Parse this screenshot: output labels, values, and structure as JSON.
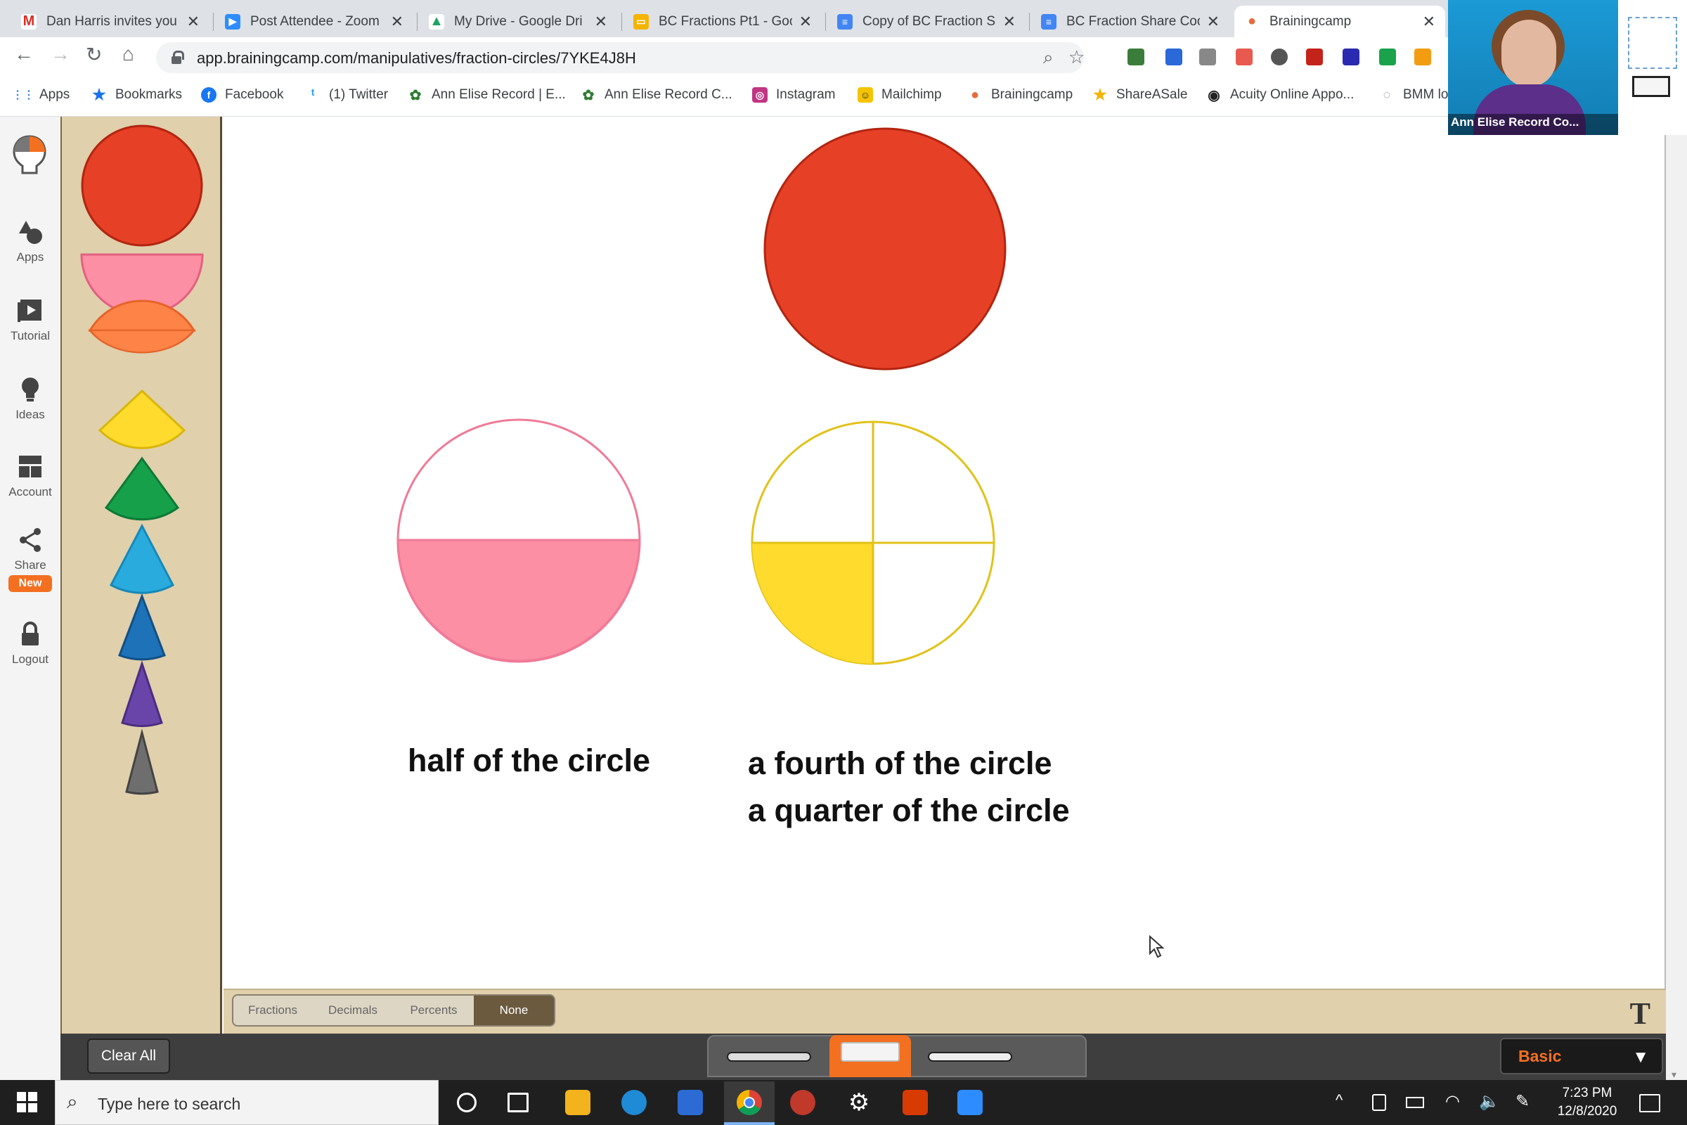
{
  "browser": {
    "tabs": [
      {
        "title": "Dan Harris invites you",
        "icon": "gmail-icon",
        "color": "#d93025",
        "glyph": "M"
      },
      {
        "title": "Post Attendee - Zoom",
        "icon": "zoom-icon",
        "color": "#2d8cff",
        "glyph": "▶"
      },
      {
        "title": "My Drive - Google Dri",
        "icon": "google-drive-icon",
        "color": "#1fa463",
        "glyph": "▲"
      },
      {
        "title": "BC Fractions Pt1 - Goo",
        "icon": "google-slides-icon",
        "color": "#f4b400",
        "glyph": "▭"
      },
      {
        "title": "Copy of BC Fraction Sl",
        "icon": "google-docs-icon",
        "color": "#4285f4",
        "glyph": "≡"
      },
      {
        "title": "BC Fraction Share Coo",
        "icon": "google-docs-icon",
        "color": "#4285f4",
        "glyph": "≡"
      },
      {
        "title": "Brainingcamp",
        "icon": "brainingcamp-icon",
        "color": "#e86a3a",
        "glyph": "●"
      }
    ],
    "url": "app.brainingcamp.com/manipulatives/fraction-circles/7YKE4J8H",
    "bookmarks": [
      {
        "label": "Apps",
        "icon": "apps-grid-icon",
        "color": "#4285f4",
        "glyph": "⋮⋮"
      },
      {
        "label": "Bookmarks",
        "icon": "star-icon",
        "color": "#1a73e8",
        "glyph": "★"
      },
      {
        "label": "Facebook",
        "icon": "facebook-icon",
        "color": "#1877f2",
        "glyph": "f"
      },
      {
        "label": "(1) Twitter",
        "icon": "twitter-icon",
        "color": "#1da1f2",
        "glyph": "t"
      },
      {
        "label": "Ann Elise Record | E...",
        "icon": "leaf-icon",
        "color": "#2e7d32",
        "glyph": "✿"
      },
      {
        "label": "Ann Elise Record C...",
        "icon": "leaf-icon",
        "color": "#2e7d32",
        "glyph": "✿"
      },
      {
        "label": "Instagram",
        "icon": "instagram-icon",
        "color": "#c13584",
        "glyph": "◎"
      },
      {
        "label": "Mailchimp",
        "icon": "mailchimp-icon",
        "color": "#f5c400",
        "glyph": "☺"
      },
      {
        "label": "Brainingcamp",
        "icon": "brainingcamp-icon",
        "color": "#e86a3a",
        "glyph": "●"
      },
      {
        "label": "ShareASale",
        "icon": "star-icon",
        "color": "#f4b400",
        "glyph": "★"
      },
      {
        "label": "Acuity Online Appo...",
        "icon": "acuity-icon",
        "color": "#222222",
        "glyph": "◉"
      },
      {
        "label": "BMM lo",
        "icon": "bmm-icon",
        "color": "#bbbbbb",
        "glyph": "○"
      }
    ]
  },
  "nav": {
    "items": [
      {
        "label": "Apps",
        "icon": "apps-shapes-icon"
      },
      {
        "label": "Tutorial",
        "icon": "tutorial-play-icon"
      },
      {
        "label": "Ideas",
        "icon": "lightbulb-icon"
      },
      {
        "label": "Account",
        "icon": "account-grid-icon"
      },
      {
        "label": "Share",
        "icon": "share-icon",
        "badge": "New"
      },
      {
        "label": "Logout",
        "icon": "lock-icon"
      }
    ]
  },
  "palette": {
    "pieces": [
      {
        "fraction": "1",
        "color": "#e64027"
      },
      {
        "fraction": "1/2",
        "color": "#fc8fa3"
      },
      {
        "fraction": "1/3",
        "color": "#fd8446"
      },
      {
        "fraction": "1/4",
        "color": "#fedb2c"
      },
      {
        "fraction": "1/5",
        "color": "#17a04a"
      },
      {
        "fraction": "1/6",
        "color": "#2aabde"
      },
      {
        "fraction": "1/8",
        "color": "#1d72b8"
      },
      {
        "fraction": "1/10",
        "color": "#6a45a9"
      },
      {
        "fraction": "1/12",
        "color": "#6e6e6e"
      }
    ]
  },
  "canvas": {
    "whole_color": "#e64027",
    "half": {
      "filled_parts": 1,
      "total_parts": 2,
      "color": "#fc8fa3",
      "label": "half of the circle"
    },
    "fourth": {
      "filled_parts": 1,
      "total_parts": 4,
      "color": "#fedb2c",
      "label_line1": "a fourth of the circle",
      "label_line2": "a quarter of the circle"
    }
  },
  "label_modes": {
    "options": [
      "Fractions",
      "Decimals",
      "Percents",
      "None"
    ],
    "selected": "None"
  },
  "text_tool": "T",
  "toolbar": {
    "clear_all": "Clear All",
    "mode": "Basic"
  },
  "video": {
    "name": "Ann Elise Record Co..."
  },
  "taskbar": {
    "search_placeholder": "Type here to search",
    "time": "7:23 PM",
    "date": "12/8/2020"
  }
}
